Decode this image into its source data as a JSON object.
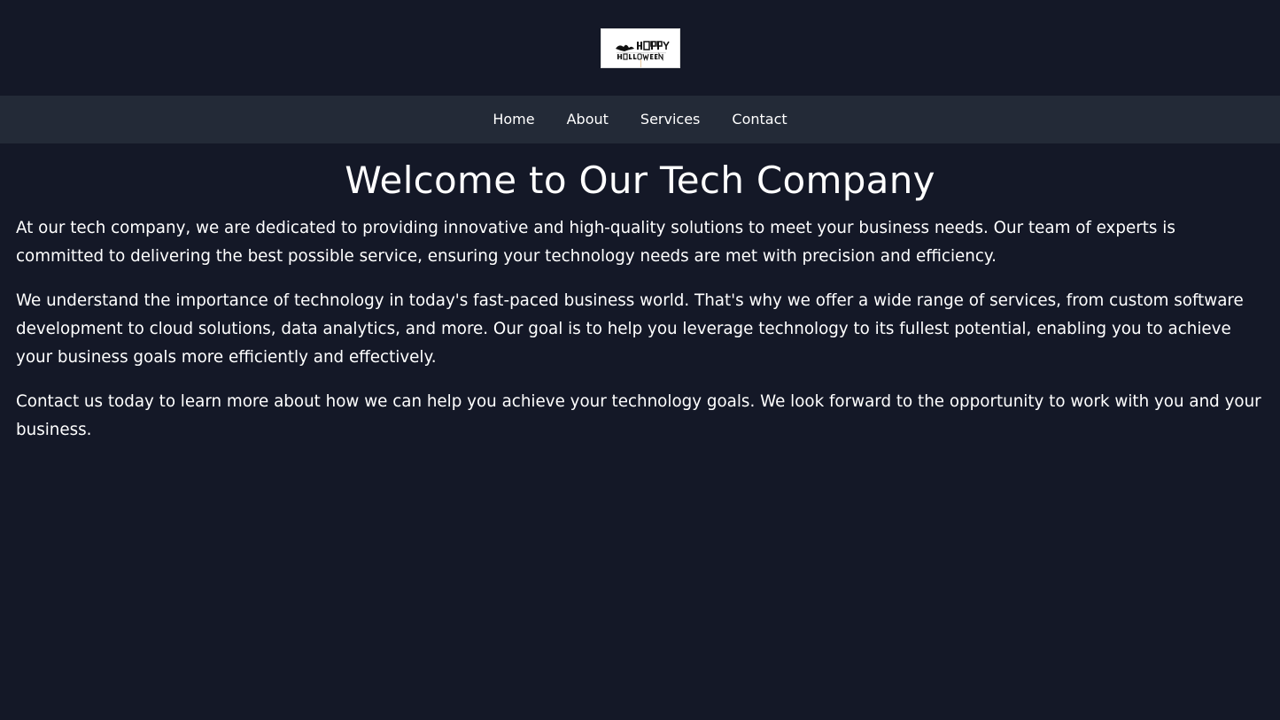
{
  "header": {
    "logo_text": "HAPPY HALLOWEEN"
  },
  "nav": {
    "items": [
      "Home",
      "About",
      "Services",
      "Contact"
    ]
  },
  "main": {
    "title": "Welcome to Our Tech Company",
    "paragraphs": [
      "At our tech company, we are dedicated to providing innovative and high-quality solutions to meet your business needs. Our team of experts is committed to delivering the best possible service, ensuring your technology needs are met with precision and efficiency.",
      "We understand the importance of technology in today's fast-paced business world. That's why we offer a wide range of services, from custom software development to cloud solutions, data analytics, and more. Our goal is to help you leverage technology to its fullest potential, enabling you to achieve your business goals more efficiently and effectively.",
      "Contact us today to learn more about how we can help you achieve your technology goals. We look forward to the opportunity to work with you and your business."
    ]
  },
  "colors": {
    "background": "#141827",
    "nav_background": "#232a37",
    "text": "#ffffff"
  }
}
